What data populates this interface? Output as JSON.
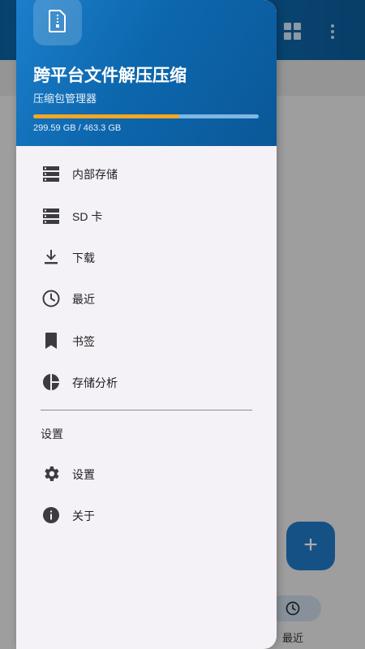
{
  "header": {
    "title": "跨平台文件解压压缩",
    "subtitle": "压缩包管理器",
    "storage_used_fraction": 0.647,
    "storage_text": "299.59 GB / 463.3 GB"
  },
  "menu": {
    "items": [
      {
        "label": "内部存储",
        "icon": "storage-icon"
      },
      {
        "label": "SD 卡",
        "icon": "sd-card-icon"
      },
      {
        "label": "下载",
        "icon": "download-icon"
      },
      {
        "label": "最近",
        "icon": "clock-icon"
      },
      {
        "label": "书签",
        "icon": "bookmark-icon"
      },
      {
        "label": "存储分析",
        "icon": "pie-chart-icon"
      }
    ],
    "section_label": "设置",
    "settings_items": [
      {
        "label": "设置",
        "icon": "gear-icon"
      },
      {
        "label": "关于",
        "icon": "info-icon"
      }
    ]
  },
  "background": {
    "fab_symbol": "+",
    "bottom_nav_recent_label": "最近"
  },
  "colors": {
    "header": "#0d67ad",
    "accent": "#f5a623",
    "drawer_bg": "#f4f1f7",
    "icon": "#3d3b42"
  }
}
